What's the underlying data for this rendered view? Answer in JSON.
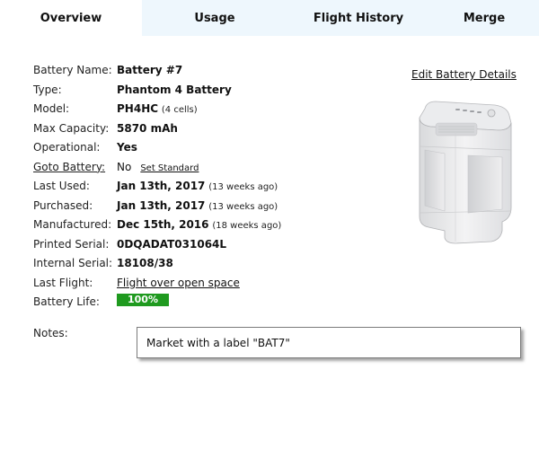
{
  "tabs": [
    {
      "label": "Overview",
      "active": true
    },
    {
      "label": "Usage"
    },
    {
      "label": "Flight History"
    },
    {
      "label": "Merge"
    }
  ],
  "details": {
    "battery_name": {
      "label": "Battery Name:",
      "value": "Battery #7"
    },
    "type": {
      "label": "Type:",
      "value": "Phantom 4 Battery"
    },
    "model": {
      "label": "Model:",
      "value": "PH4HC",
      "note": "(4 cells)"
    },
    "max_capacity": {
      "label": "Max Capacity:",
      "value": "5870 mAh"
    },
    "operational": {
      "label": "Operational:",
      "value": "Yes"
    },
    "goto_battery": {
      "label": "Goto Battery:",
      "value": "No",
      "action": "Set Standard"
    },
    "last_used": {
      "label": "Last Used:",
      "value": "Jan 13th, 2017",
      "note": "(13 weeks ago)"
    },
    "purchased": {
      "label": "Purchased:",
      "value": "Jan 13th, 2017",
      "note": "(13 weeks ago)"
    },
    "manufactured": {
      "label": "Manufactured:",
      "value": "Dec 15th, 2016",
      "note": "(18 weeks ago)"
    },
    "printed_serial": {
      "label": "Printed Serial:",
      "value": "0DQADAT031064L"
    },
    "internal_serial": {
      "label": "Internal Serial:",
      "value": "18108/38"
    },
    "last_flight": {
      "label": "Last Flight:",
      "value": "Flight over open space"
    },
    "battery_life": {
      "label": "Battery Life:",
      "value": "100%",
      "percent": 100
    }
  },
  "edit_link": "Edit Battery Details",
  "notes": {
    "label": "Notes:",
    "text": "Market with a label \"BAT7\""
  },
  "colors": {
    "tab_bg": "#eef7fd",
    "life_bar": "#1f9a1f"
  }
}
